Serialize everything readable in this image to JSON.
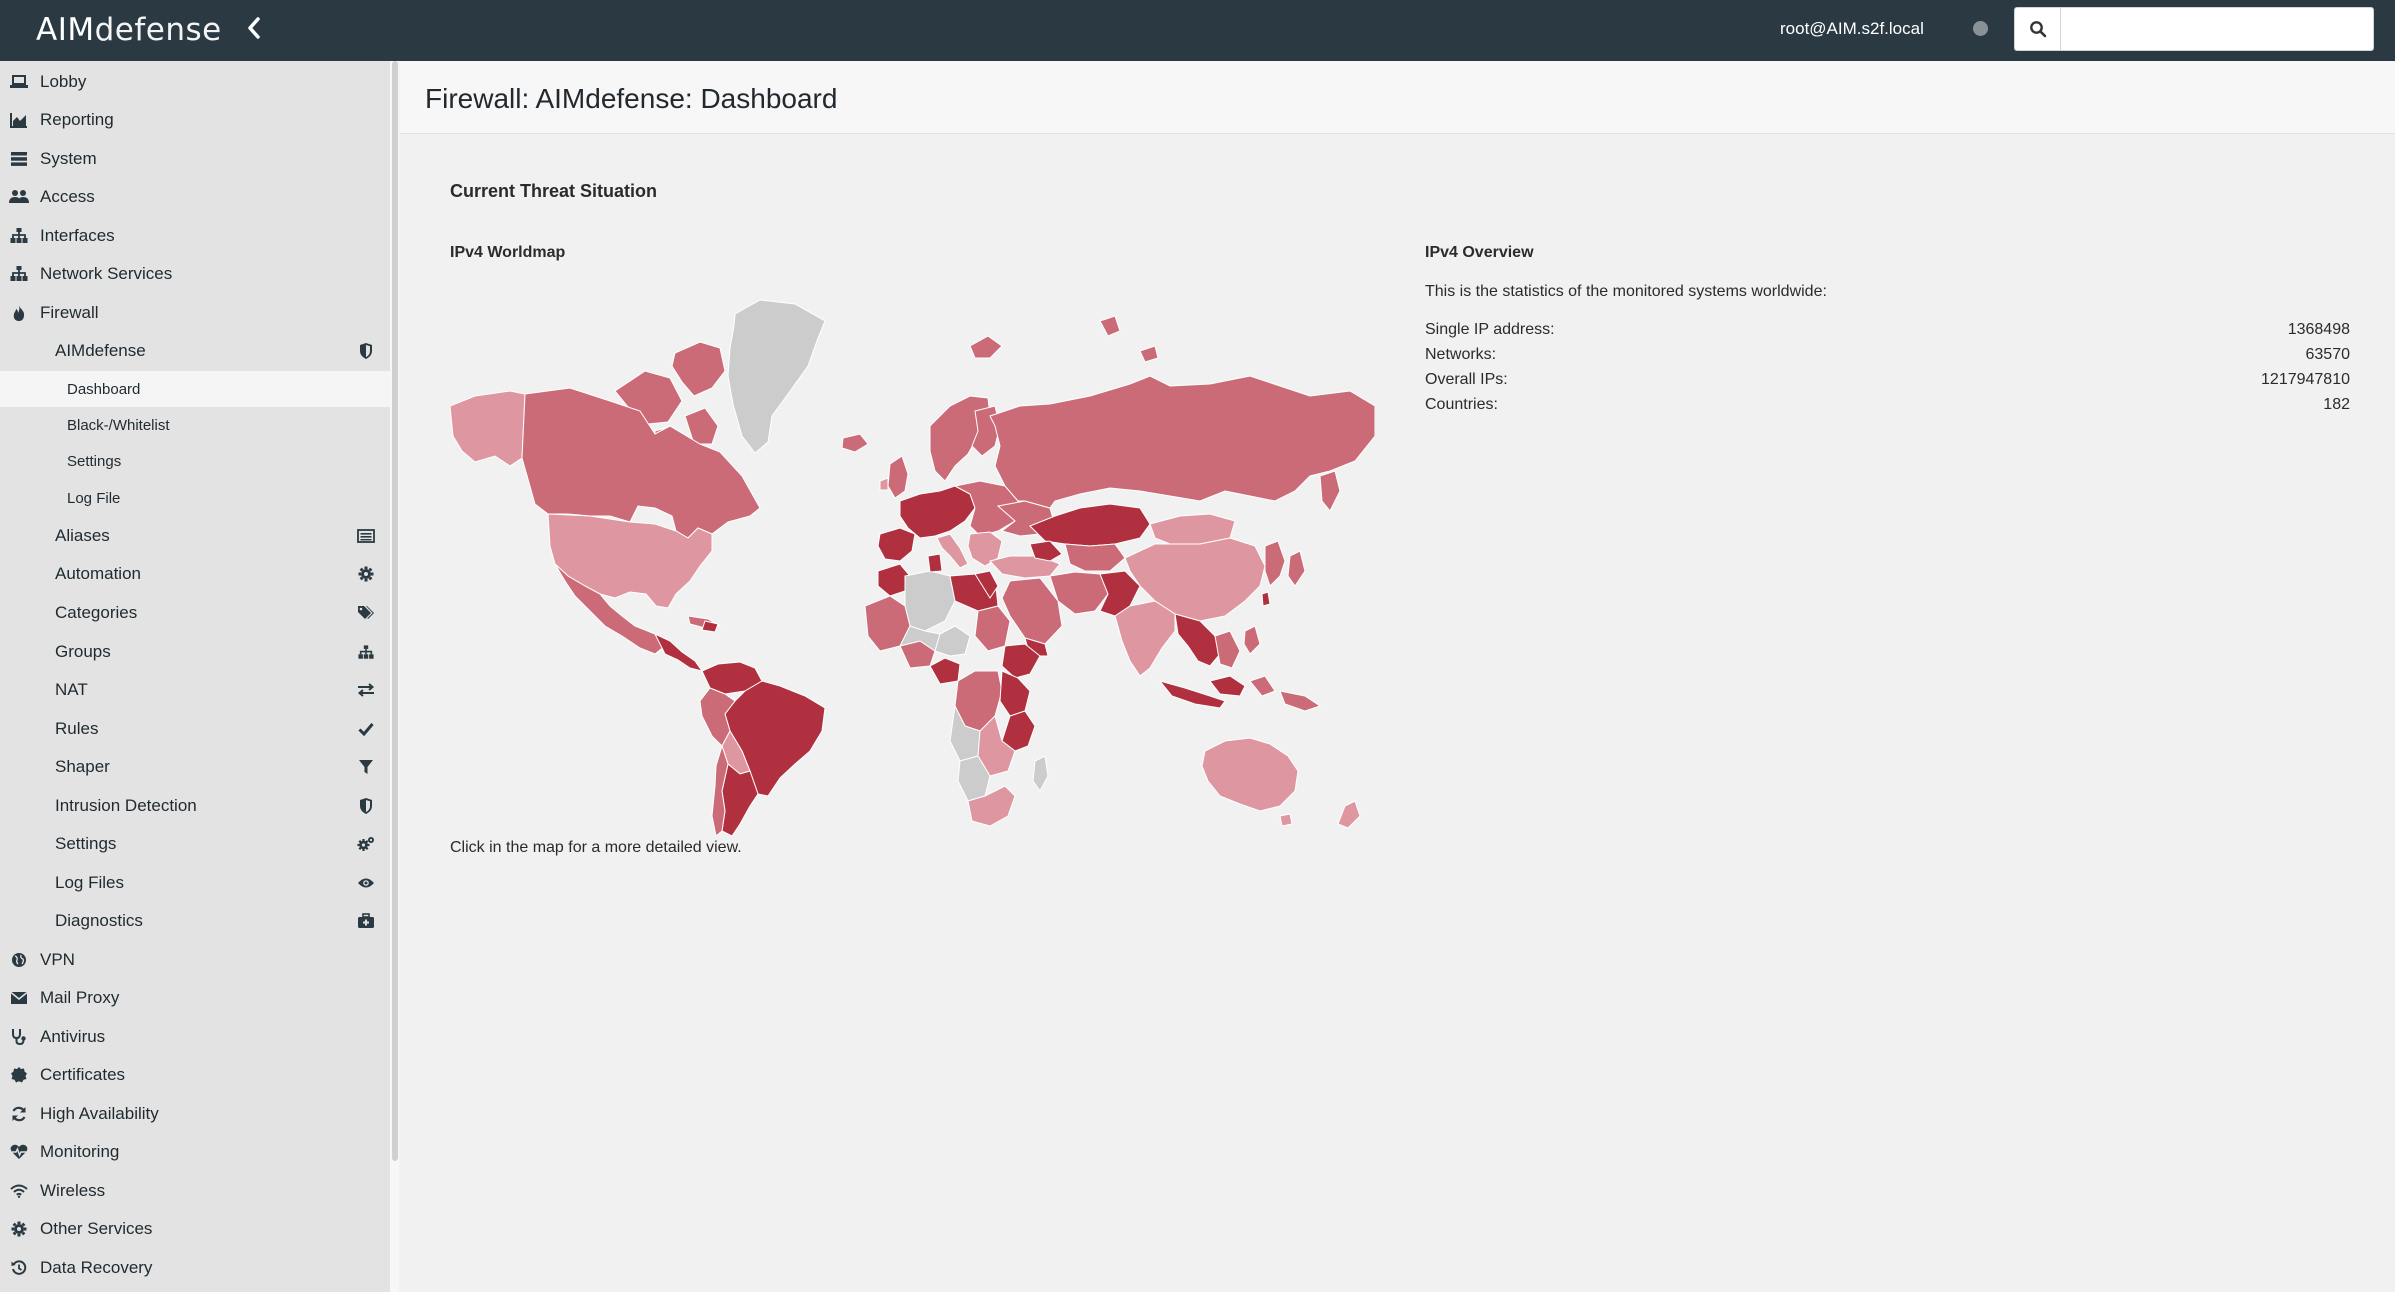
{
  "brand": {
    "name_bold": "AIM",
    "name_light": "defense"
  },
  "header": {
    "user": "root@AIM.s2f.local",
    "search_placeholder": ""
  },
  "sidebar": {
    "top_items": [
      {
        "label": "Lobby",
        "icon": "laptop-icon"
      },
      {
        "label": "Reporting",
        "icon": "area-chart-icon"
      },
      {
        "label": "System",
        "icon": "server-icon"
      },
      {
        "label": "Access",
        "icon": "users-icon"
      },
      {
        "label": "Interfaces",
        "icon": "sitemap-icon"
      },
      {
        "label": "Network Services",
        "icon": "sitemap-icon"
      },
      {
        "label": "Firewall",
        "icon": "fire-icon"
      }
    ],
    "firewall_children": [
      {
        "label": "AIMdefense",
        "icon": "shield-icon"
      },
      {
        "label": "Aliases",
        "icon": "list-alt-icon"
      },
      {
        "label": "Automation",
        "icon": "cog-icon"
      },
      {
        "label": "Categories",
        "icon": "tags-icon"
      },
      {
        "label": "Groups",
        "icon": "sitemap-icon"
      },
      {
        "label": "NAT",
        "icon": "exchange-icon"
      },
      {
        "label": "Rules",
        "icon": "check-icon"
      },
      {
        "label": "Shaper",
        "icon": "filter-icon"
      },
      {
        "label": "Intrusion Detection",
        "icon": "shield-icon"
      },
      {
        "label": "Settings",
        "icon": "cogs-icon"
      },
      {
        "label": "Log Files",
        "icon": "eye-icon"
      },
      {
        "label": "Diagnostics",
        "icon": "medkit-icon"
      }
    ],
    "aimdefense_children": [
      {
        "label": "Dashboard",
        "active": true
      },
      {
        "label": "Black-/Whitelist",
        "active": false
      },
      {
        "label": "Settings",
        "active": false
      },
      {
        "label": "Log File",
        "active": false
      }
    ],
    "bottom_items": [
      {
        "label": "VPN",
        "icon": "globe-icon"
      },
      {
        "label": "Mail Proxy",
        "icon": "envelope-icon"
      },
      {
        "label": "Antivirus",
        "icon": "stethoscope-icon"
      },
      {
        "label": "Certificates",
        "icon": "certificate-icon"
      },
      {
        "label": "High Availability",
        "icon": "refresh-icon"
      },
      {
        "label": "Monitoring",
        "icon": "heartbeat-icon"
      },
      {
        "label": "Wireless",
        "icon": "wifi-icon"
      },
      {
        "label": "Other Services",
        "icon": "cog-icon"
      },
      {
        "label": "Data Recovery",
        "icon": "history-icon"
      }
    ]
  },
  "page": {
    "title": "Firewall: AIMdefense: Dashboard",
    "section_title": "Current Threat Situation",
    "map": {
      "title": "IPv4 Worldmap",
      "note": "Click in the map for a more detailed view.",
      "colors": {
        "high": "#b0303f",
        "mid": "#cc6b78",
        "low": "#de97a1",
        "none": "#cccccc",
        "ocean": "#f1f1f1"
      }
    },
    "overview": {
      "title": "IPv4 Overview",
      "description": "This is the statistics of the monitored systems worldwide:",
      "rows": [
        {
          "label": "Single IP address:",
          "value": "1368498"
        },
        {
          "label": "Networks:",
          "value": "63570"
        },
        {
          "label": "Overall IPs:",
          "value": "1217947810"
        },
        {
          "label": "Countries:",
          "value": "182"
        }
      ]
    }
  }
}
